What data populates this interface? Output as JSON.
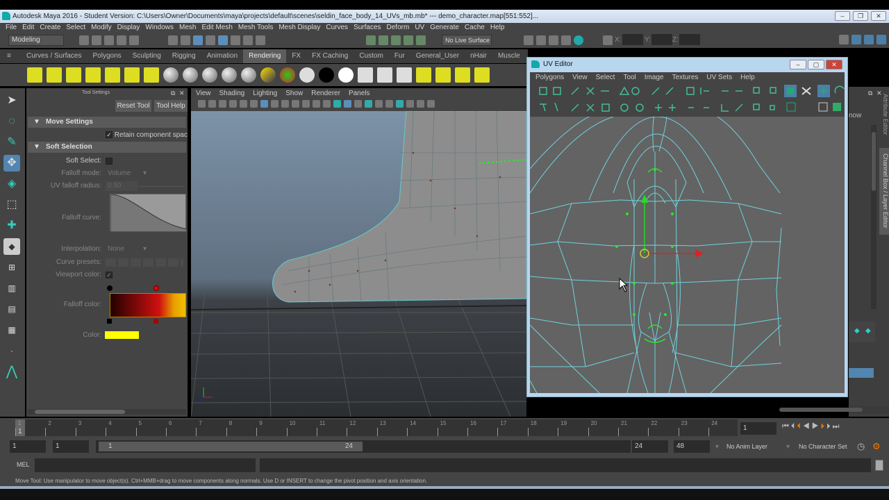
{
  "title": "Autodesk Maya 2016 - Student Version: C:\\Users\\Owner\\Documents\\maya\\projects\\default\\scenes\\seldin_face_body_14_UVs_mb.mb*   ---   demo_character.map[551:552]...",
  "menus": [
    "File",
    "Edit",
    "Create",
    "Select",
    "Modify",
    "Display",
    "Windows",
    "Mesh",
    "Edit Mesh",
    "Mesh Tools",
    "Mesh Display",
    "Curves",
    "Surfaces",
    "Deform",
    "UV",
    "Generate",
    "Cache",
    "Help"
  ],
  "status": {
    "mode": "Modeling",
    "live_surface": "No Live Surface",
    "x_label": "X:",
    "y_label": "Y:",
    "z_label": "Z:"
  },
  "shelf_tabs": [
    "Curves / Surfaces",
    "Polygons",
    "Sculpting",
    "Rigging",
    "Animation",
    "Rendering",
    "FX",
    "FX Caching",
    "Custom",
    "Fur",
    "General_User",
    "nHair",
    "Muscle"
  ],
  "active_shelf": "Rendering",
  "tool_settings": {
    "title": "Tool Settings",
    "reset": "Reset Tool",
    "help": "Tool Help",
    "move_settings": "Move Settings",
    "retain": "Retain component spacing",
    "soft_selection": "Soft Selection",
    "soft_select": "Soft Select:",
    "falloff_mode": "Falloff mode:",
    "falloff_mode_value": "Volume",
    "uv_radius": "UV falloff radius:",
    "uv_radius_value": "0.50",
    "falloff_curve": "Falloff curve:",
    "interpolation": "Interpolation:",
    "interpolation_value": "None",
    "curve_presets": "Curve presets:",
    "viewport_color": "Viewport color:",
    "falloff_color": "Falloff color:",
    "color": "Color:",
    "color_swatch": "#ffff00"
  },
  "viewport": {
    "menus": [
      "View",
      "Shading",
      "Lighting",
      "Show",
      "Renderer",
      "Panels"
    ]
  },
  "uv_editor": {
    "title": "UV Editor",
    "menus": [
      "Polygons",
      "View",
      "Select",
      "Tool",
      "Image",
      "Textures",
      "UV Sets",
      "Help"
    ]
  },
  "right_panel": {
    "tabs": [
      "Attribute Editor",
      "Channel Box / Layer Editor"
    ],
    "partial_text": "now"
  },
  "timeline": {
    "ticks": [
      "1",
      "2",
      "3",
      "4",
      "5",
      "6",
      "7",
      "8",
      "9",
      "10",
      "11",
      "12",
      "13",
      "14",
      "15",
      "16",
      "17",
      "18",
      "19",
      "20",
      "21",
      "22",
      "23",
      "24"
    ],
    "current_frame": "1",
    "current_field": "1"
  },
  "range": {
    "start": "1",
    "playback_start": "1",
    "slider_start": "1",
    "slider_end": "24",
    "playback_end": "24",
    "end": "48",
    "anim_layer": "No Anim Layer",
    "character_set": "No Character Set"
  },
  "mel": {
    "label": "MEL"
  },
  "help_line": "Move Tool: Use manipulator to move object(s). Ctrl+MMB+drag to move components along normals. Use D or INSERT to change the pivot position and axis orientation."
}
